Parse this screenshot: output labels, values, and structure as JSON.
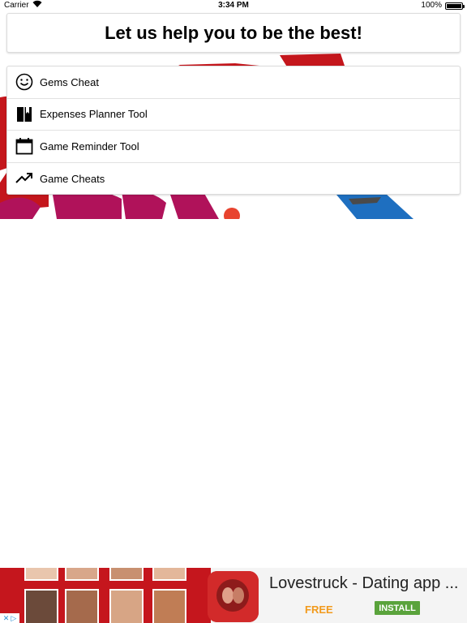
{
  "status_bar": {
    "carrier": "Carrier",
    "time": "3:34 PM",
    "battery": "100%",
    "battery_level": 1.0
  },
  "header": {
    "title": "Let us help you to be the best!"
  },
  "menu": {
    "items": [
      {
        "label": "Gems Cheat",
        "icon": "smiley-icon"
      },
      {
        "label": "Expenses Planner Tool",
        "icon": "book-icon"
      },
      {
        "label": "Game Reminder Tool",
        "icon": "calendar-icon"
      },
      {
        "label": "Game Cheats",
        "icon": "trending-up-icon"
      }
    ]
  },
  "ad": {
    "title": "Lovestruck - Dating app ...",
    "price": "FREE",
    "install_label": "INSTALL",
    "colors": {
      "accent_red": "#c5161d",
      "free_orange": "#f29a1c",
      "install_green": "#5aa33c"
    }
  },
  "colors": {
    "background": "#ffffff",
    "art_red": "#c4161c",
    "art_magenta": "#b0125a",
    "art_blue": "#1e6fc0"
  }
}
